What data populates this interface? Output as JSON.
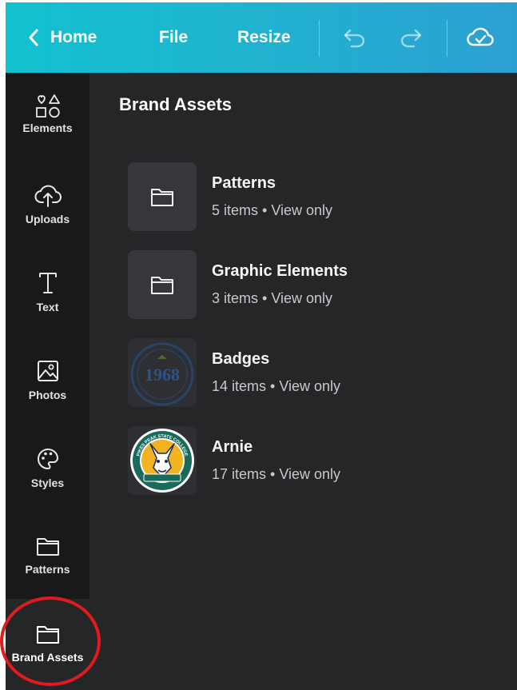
{
  "topbar": {
    "back_label": "Home",
    "file_label": "File",
    "resize_label": "Resize",
    "icons": [
      "chevron-left-icon",
      "undo-icon",
      "redo-icon",
      "cloud-saved-icon"
    ]
  },
  "sidebar": {
    "items": [
      {
        "label": "Elements",
        "icon": "shapes-icon"
      },
      {
        "label": "Uploads",
        "icon": "cloud-upload-icon"
      },
      {
        "label": "Text",
        "icon": "text-icon"
      },
      {
        "label": "Photos",
        "icon": "image-icon"
      },
      {
        "label": "Styles",
        "icon": "palette-icon"
      },
      {
        "label": "Patterns",
        "icon": "folder-icon"
      },
      {
        "label": "Brand Assets",
        "icon": "folder-icon",
        "selected": true
      }
    ]
  },
  "panel": {
    "title": "Brand Assets",
    "folders": [
      {
        "name": "Patterns",
        "meta": "5 items • View only",
        "thumb": "folder-icon"
      },
      {
        "name": "Graphic Elements",
        "meta": "3 items • View only",
        "thumb": "folder-icon"
      },
      {
        "name": "Badges",
        "meta": "14 items • View only",
        "thumb": "badge-1968-image",
        "badge_text": "1968"
      },
      {
        "name": "Arnie",
        "meta": "17 items • View only",
        "thumb": "arnie-logo-image",
        "logo_text": "PIKES PEAK STATE COLLEGE"
      }
    ]
  },
  "colors": {
    "topbar_start": "#12c1d0",
    "topbar_end": "#2ca0d3",
    "sidebar_bg": "#18191b",
    "panel_bg": "#252627",
    "highlight": "#e11b1b"
  }
}
